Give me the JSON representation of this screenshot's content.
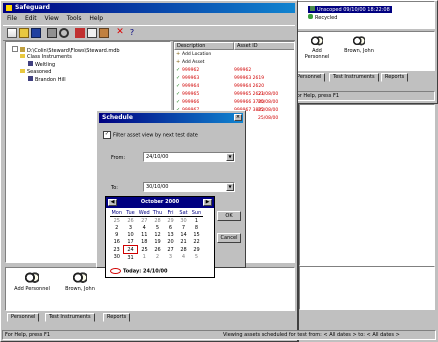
{
  "app": {
    "title": "Safeguard",
    "menu": [
      "File",
      "Edit",
      "View",
      "Tools",
      "Help"
    ],
    "tree": {
      "root": "D:\\Colin\\Steward\\Flows\\Steward.mdb",
      "items": [
        {
          "label": "Class Instruments"
        },
        {
          "label": "Weltling"
        },
        {
          "label": "Seasoned"
        },
        {
          "label": "Brandon Hill"
        }
      ]
    },
    "grid": {
      "columns": [
        "Description",
        "Asset ID"
      ],
      "rows": [
        {
          "description": "Add Location",
          "asset": "",
          "status": "",
          "d1": "",
          "d2": ""
        },
        {
          "description": "Add Asset",
          "asset": "",
          "status": "",
          "d1": "",
          "d2": ""
        },
        {
          "description": "999962",
          "asset": "999962",
          "status": "",
          "d1": "",
          "d2": ""
        },
        {
          "description": "999963",
          "asset": "999963 2619",
          "status": "",
          "d1": "",
          "d2": ""
        },
        {
          "description": "999964",
          "asset": "999964 2620",
          "status": "",
          "d1": "",
          "d2": ""
        },
        {
          "description": "999965",
          "asset": "999965 2621",
          "status": "",
          "d1": "23/08/00",
          "d2": "23/08/09"
        },
        {
          "description": "999966",
          "asset": "999966 3700",
          "status": "",
          "d1": "25/08/00",
          "d2": ""
        },
        {
          "description": "999967",
          "asset": "999967 3802",
          "status": "",
          "d1": "25/08/00",
          "d2": ""
        },
        {
          "description": "",
          "asset": "",
          "status": "",
          "d1": "25/08/00",
          "d2": ""
        }
      ]
    },
    "people": [
      {
        "name": "Add Personnel"
      },
      {
        "name": "Brown, John"
      }
    ],
    "tabs": [
      "Personnel",
      "Test Instruments",
      "Reports"
    ],
    "status_left": "For Help, press F1",
    "status_right": "Viewing assets scheduled for test from: < All dates > to: < All dates >"
  },
  "background_window": {
    "items": [
      "Unscoped 09/10/00 18:22:08",
      "Recycled"
    ],
    "people": [
      {
        "name": "Add Personnel"
      },
      {
        "name": "Brown, John"
      }
    ],
    "tabs": [
      "Personnel",
      "Test Instruments",
      "Reports"
    ],
    "status": "For Help, press F1"
  },
  "dialog": {
    "title": "Schedule",
    "checkbox_label": "Filter asset view by next test date",
    "checkbox_checked": true,
    "from_label": "From:",
    "from_value": "24/10/00",
    "to_label": "To:",
    "to_value": "30/10/00",
    "ok_label": "OK",
    "cancel_label": "Cancel",
    "calendar": {
      "month_label": "October 2000",
      "weekdays": [
        "Mon",
        "Tue",
        "Wed",
        "Thu",
        "Fri",
        "Sat",
        "Sun"
      ],
      "weeks": [
        [
          "25",
          "26",
          "27",
          "28",
          "29",
          "30",
          "1"
        ],
        [
          "2",
          "3",
          "4",
          "5",
          "6",
          "7",
          "8"
        ],
        [
          "9",
          "10",
          "11",
          "12",
          "13",
          "14",
          "15"
        ],
        [
          "16",
          "17",
          "18",
          "19",
          "20",
          "21",
          "22"
        ],
        [
          "23",
          "24",
          "25",
          "26",
          "27",
          "28",
          "29"
        ],
        [
          "30",
          "31",
          "1",
          "2",
          "3",
          "4",
          "5"
        ]
      ],
      "today_label": "Today: 24/10/00",
      "selected_day": "24"
    }
  },
  "colors": {
    "title_active": "#000080",
    "desktop": "#008080",
    "red_text": "#d00000"
  }
}
